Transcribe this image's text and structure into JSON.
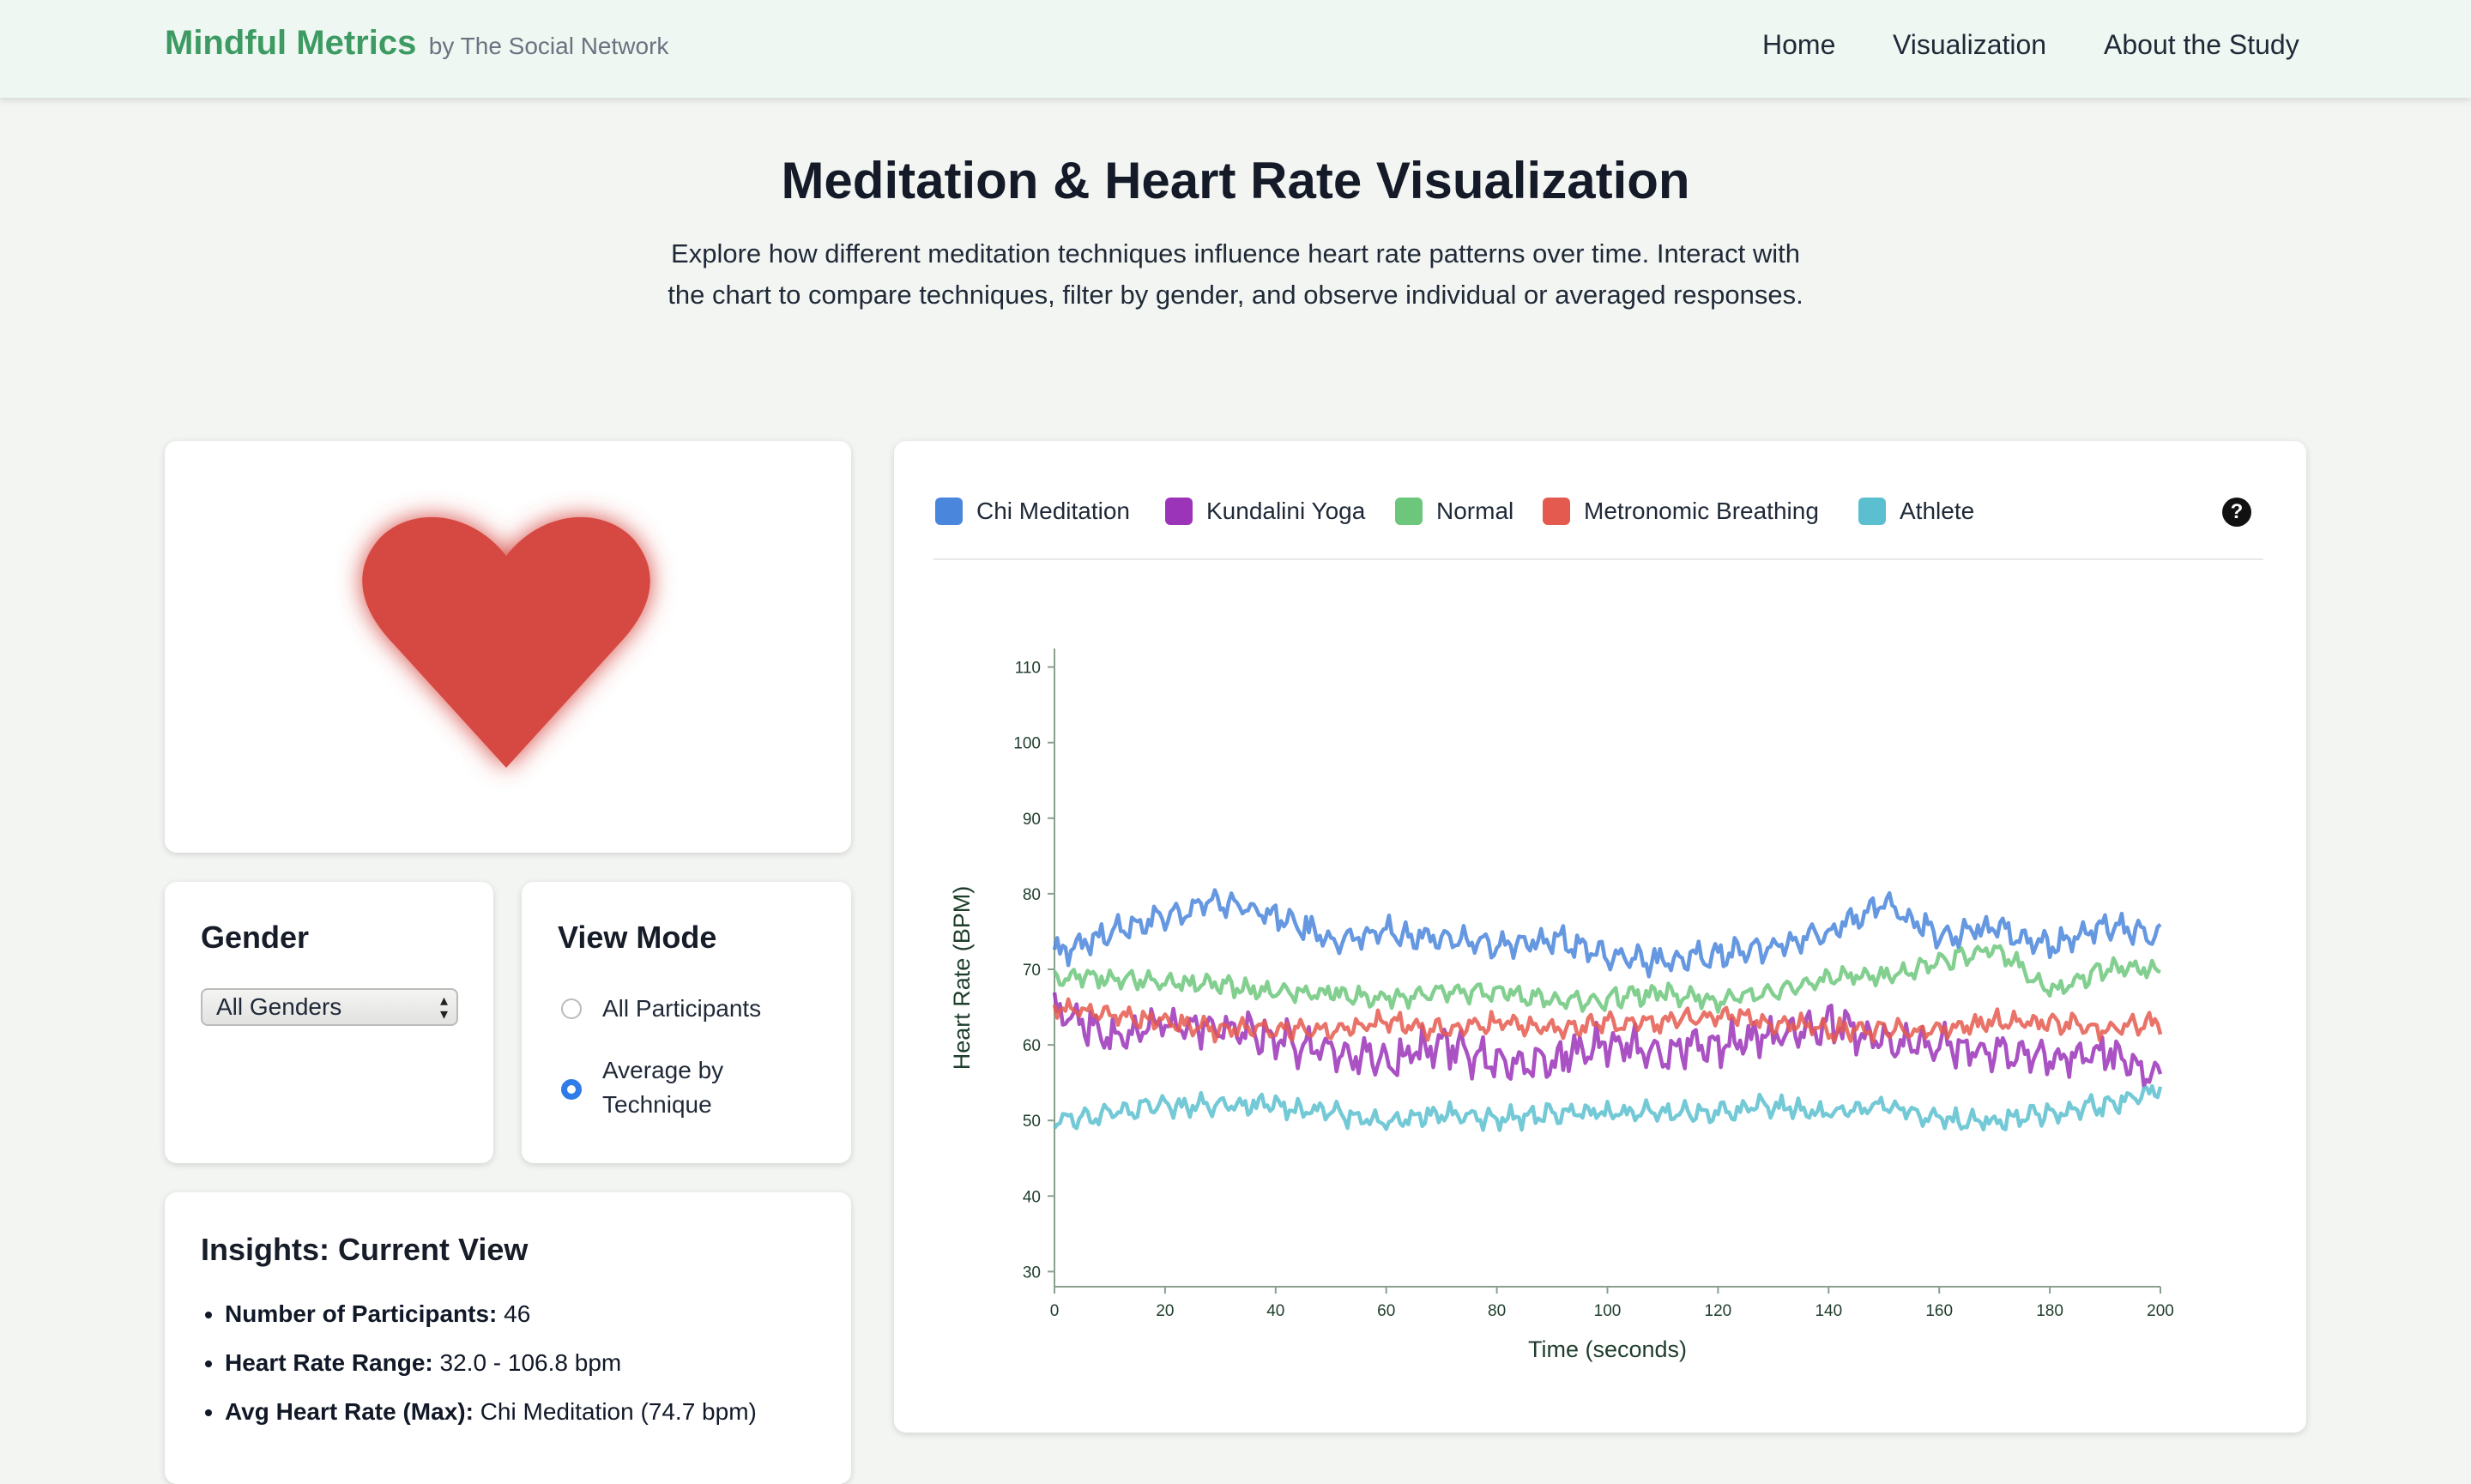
{
  "header": {
    "brand": "Mindful Metrics",
    "brand_sub": "by The Social Network",
    "nav": [
      "Home",
      "Visualization",
      "About the Study"
    ]
  },
  "page": {
    "title": "Meditation & Heart Rate Visualization",
    "description": "Explore how different meditation techniques influence heart rate patterns over time. Interact with the chart to compare techniques, filter by gender, and observe individual or averaged responses."
  },
  "gender": {
    "title": "Gender",
    "selected": "All Genders"
  },
  "view_mode": {
    "title": "View Mode",
    "options": [
      "All Participants",
      "Average by Technique"
    ],
    "selected_index": 1
  },
  "insights": {
    "title": "Insights: Current View",
    "items": [
      {
        "label": "Number of Participants:",
        "value": "46"
      },
      {
        "label": "Heart Rate Range:",
        "value": "32.0 - 106.8 bpm"
      },
      {
        "label": "Avg Heart Rate (Max):",
        "value": "Chi Meditation (74.7 bpm)"
      }
    ]
  },
  "colors": {
    "accent_green": "#3d9a62",
    "heart": "#d64a42",
    "radio_selected": "#2f7be8"
  },
  "icons": [
    "heart-icon",
    "help-icon",
    "select-arrows-icon"
  ],
  "chart_data": {
    "type": "line",
    "xlabel": "Time (seconds)",
    "ylabel": "Heart Rate (BPM)",
    "xlim": [
      0,
      200
    ],
    "ylim": [
      28,
      112
    ],
    "xticks": [
      0,
      20,
      40,
      60,
      80,
      100,
      120,
      140,
      160,
      180,
      200
    ],
    "yticks": [
      30,
      40,
      50,
      60,
      70,
      80,
      90,
      100,
      110
    ],
    "grid": false,
    "legend_position": "top",
    "x": [
      0,
      10,
      20,
      30,
      40,
      50,
      60,
      70,
      80,
      90,
      100,
      110,
      120,
      130,
      140,
      150,
      160,
      170,
      180,
      190,
      200
    ],
    "series": [
      {
        "name": "Chi Meditation",
        "color": "#4a86dc",
        "values": [
          72,
          75,
          77,
          79,
          77,
          74,
          75,
          74,
          73,
          74,
          72,
          71,
          72,
          73,
          75,
          79,
          74,
          76,
          73,
          76,
          74
        ]
      },
      {
        "name": "Kundalini Yoga",
        "color": "#9b34b8",
        "values": [
          65,
          61,
          63,
          62,
          61,
          59,
          58,
          60,
          58,
          58,
          60,
          59,
          60,
          61,
          63,
          60,
          60,
          59,
          58,
          59,
          56
        ]
      },
      {
        "name": "Normal",
        "color": "#6cc77c",
        "values": [
          69,
          69,
          68,
          68,
          67,
          67,
          66,
          67,
          67,
          66,
          66,
          67,
          66,
          67,
          69,
          69,
          71,
          73,
          67,
          70,
          70
        ]
      },
      {
        "name": "Metronomic Breathing",
        "color": "#e55a4e",
        "values": [
          65,
          64,
          63,
          62,
          62,
          62,
          63,
          62,
          63,
          62,
          63,
          63,
          64,
          63,
          62,
          62,
          62,
          63,
          63,
          62,
          63
        ]
      },
      {
        "name": "Athlete",
        "color": "#5bbfcf",
        "values": [
          50,
          51,
          52,
          52,
          52,
          51,
          50,
          51,
          50,
          51,
          51,
          51,
          51,
          52,
          51,
          52,
          50,
          50,
          51,
          52,
          54
        ]
      }
    ]
  }
}
